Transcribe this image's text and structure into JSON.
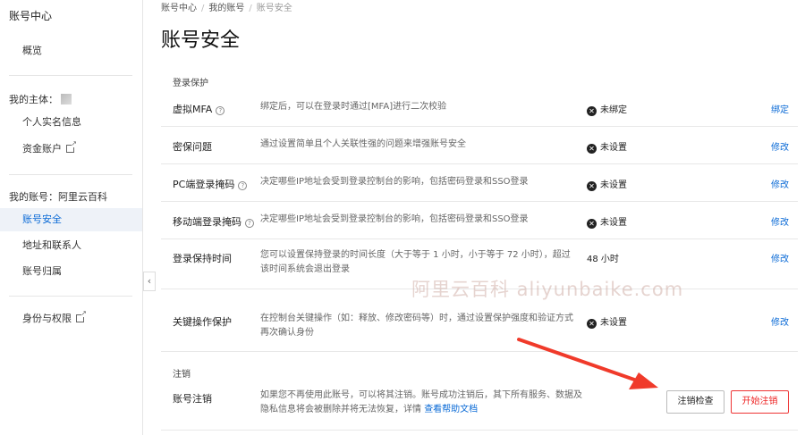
{
  "sidebar": {
    "title": "账号中心",
    "overview": "概览",
    "my_subject_label": "我的主体：",
    "real_name": "个人实名信息",
    "funds_account": "资金账户",
    "my_account_label": "我的账号：阿里云百科",
    "account_security": "账号安全",
    "address_contacts": "地址和联系人",
    "account_ownership": "账号归属",
    "identity_permissions": "身份与权限"
  },
  "breadcrumb": {
    "items": [
      "账号中心",
      "我的账号",
      "账号安全"
    ]
  },
  "page_title": "账号安全",
  "login_protection": {
    "section_label": "登录保护",
    "rows": [
      {
        "name": "虚拟MFA",
        "desc": "绑定后，可以在登录时通过[MFA]进行二次校验",
        "status": "未绑定",
        "action": "绑定"
      },
      {
        "name": "密保问题",
        "desc": "通过设置简单且个人关联性强的问题来增强账号安全",
        "status": "未设置",
        "action": "修改"
      },
      {
        "name": "PC端登录掩码",
        "desc": "决定哪些IP地址会受到登录控制台的影响，包括密码登录和SSO登录",
        "status": "未设置",
        "action": "修改"
      },
      {
        "name": "移动端登录掩码",
        "desc": "决定哪些IP地址会受到登录控制台的影响，包括密码登录和SSO登录",
        "status": "未设置",
        "action": "修改"
      },
      {
        "name": "登录保持时间",
        "desc": "您可以设置保持登录的时间长度（大于等于 1 小时，小于等于 72 小时），超过该时间系统会退出登录",
        "status": "48 小时",
        "action": "修改"
      },
      {
        "name": "关键操作保护",
        "desc": "在控制台关键操作（如：释放、修改密码等）时，通过设置保护强度和验证方式再次确认身份",
        "status": "未设置",
        "action": "修改"
      }
    ]
  },
  "cancellation": {
    "section_label": "注销",
    "name": "账号注销",
    "desc": "如果您不再使用此账号，可以将其注销。账号成功注销后，其下所有服务、数据及隐私信息将会被删除并将无法恢复，详情",
    "help_link": "查看帮助文档",
    "check_button": "注销检查",
    "start_button": "开始注销"
  },
  "watermark": "阿里云百科 aliyunbaike.com",
  "colors": {
    "accent": "#0a6ad6",
    "danger": "#e22222",
    "arrow": "#f03a2a"
  },
  "icons": {
    "help": "question-circle-icon",
    "unset": "x-circle-icon",
    "external": "external-link-icon",
    "collapse": "chevron-left-icon"
  }
}
